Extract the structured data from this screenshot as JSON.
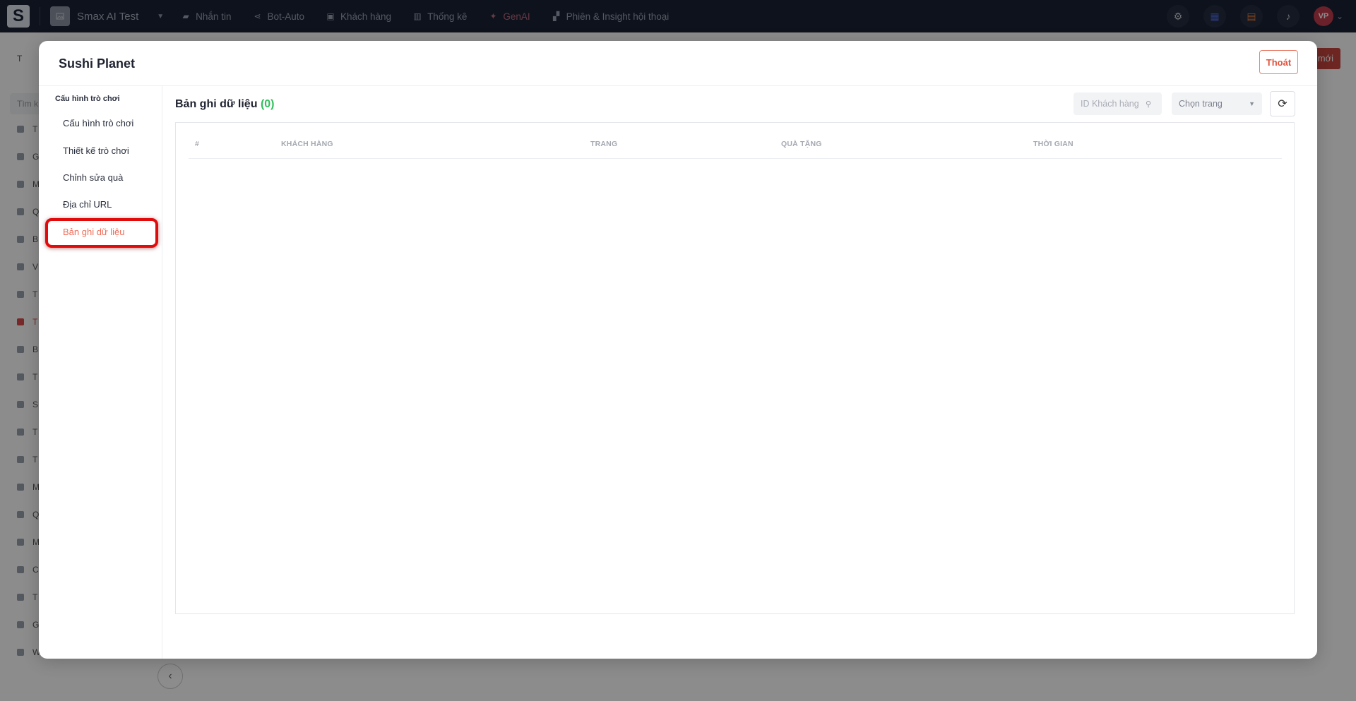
{
  "topbar": {
    "logo": "S",
    "workspace": "Smax AI Test",
    "nav": [
      {
        "label": "Nhắn tin",
        "icon": "chat-icon"
      },
      {
        "label": "Bot-Auto",
        "icon": "share-nodes-icon"
      },
      {
        "label": "Khách hàng",
        "icon": "contact-card-icon"
      },
      {
        "label": "Thống kê",
        "icon": "bar-chart-icon"
      },
      {
        "label": "GenAI",
        "icon": "sparkle-icon"
      },
      {
        "label": "Phiên & Insight hội thoại",
        "icon": "conversation-icon"
      }
    ],
    "user_initials": "VP"
  },
  "background": {
    "search_placeholder": "Tìm k",
    "sidebar_rows": [
      "T",
      "G",
      "M",
      "Q",
      "B",
      "V",
      "T",
      "T",
      "B",
      "T",
      "S",
      "T",
      "T",
      "M",
      "Q",
      "M",
      "C",
      "T",
      "G",
      "W"
    ],
    "header_left": "T",
    "new_button_label": "mới"
  },
  "modal": {
    "title": "Sushi Planet",
    "exit_label": "Thoát",
    "sidebar": {
      "heading": "Cấu hình trò chơi",
      "items": [
        {
          "label": "Cấu hình trò chơi"
        },
        {
          "label": "Thiết kế trò chơi"
        },
        {
          "label": "Chỉnh sửa quà"
        },
        {
          "label": "Địa chỉ URL"
        },
        {
          "label": "Bản ghi dữ liệu"
        }
      ],
      "active_index": 4
    },
    "content": {
      "title": "Bản ghi dữ liệu",
      "count": "(0)",
      "search_placeholder": "ID Khách hàng",
      "page_select": "Chọn trang",
      "table": {
        "columns": [
          "#",
          "KHÁCH HÀNG",
          "TRANG",
          "QUÀ TẶNG",
          "THỜI GIAN"
        ],
        "rows": []
      }
    }
  },
  "colors": {
    "topbar_bg": "#1b2233",
    "accent": "#ef6d59",
    "count_green": "#2fbf5c",
    "highlight_red": "#e20b0b"
  }
}
